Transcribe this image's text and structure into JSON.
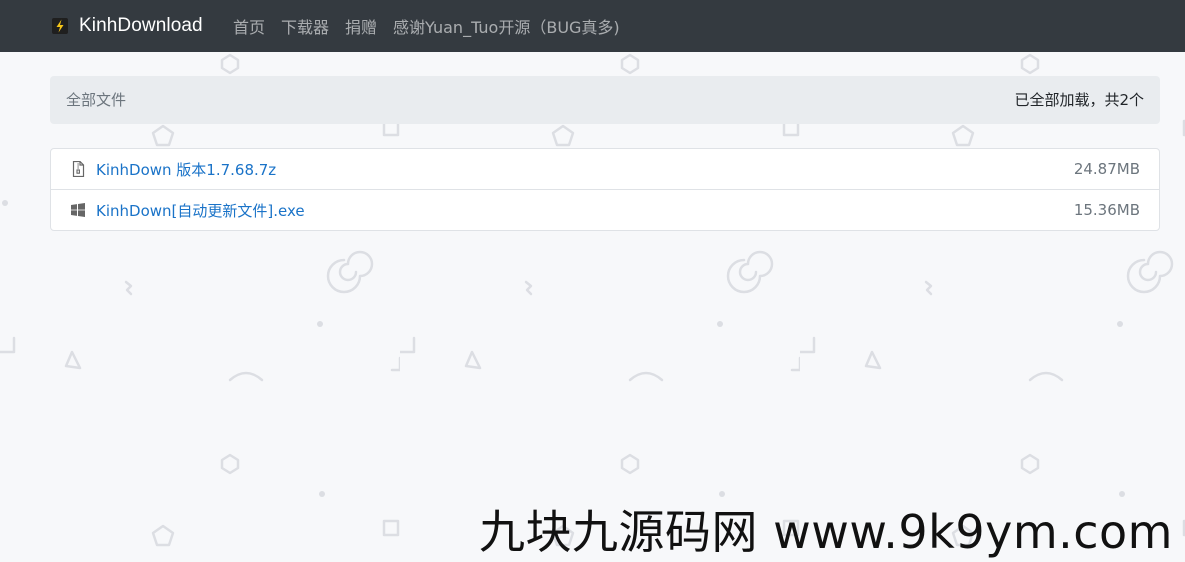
{
  "navbar": {
    "brand": "KinhDownload",
    "links": [
      {
        "label": "首页"
      },
      {
        "label": "下载器"
      },
      {
        "label": "捐赠"
      },
      {
        "label": "感谢Yuan_Tuo开源（BUG真多)"
      }
    ]
  },
  "breadcrumb": {
    "current": "全部文件",
    "status": "已全部加载，共2个"
  },
  "files": [
    {
      "name": "KinhDown 版本1.7.68.7z",
      "size": "24.87MB",
      "icon": "archive-file-icon"
    },
    {
      "name": "KinhDown[自动更新文件].exe",
      "size": "15.36MB",
      "icon": "windows-icon"
    }
  ],
  "watermark": "九块九源码网 www.9k9ym.com",
  "colors": {
    "navbar_bg": "#343a40",
    "link": "#1a73c8",
    "breadcrumb_bg": "#e9ecef",
    "page_bg": "#f7f8fa"
  }
}
